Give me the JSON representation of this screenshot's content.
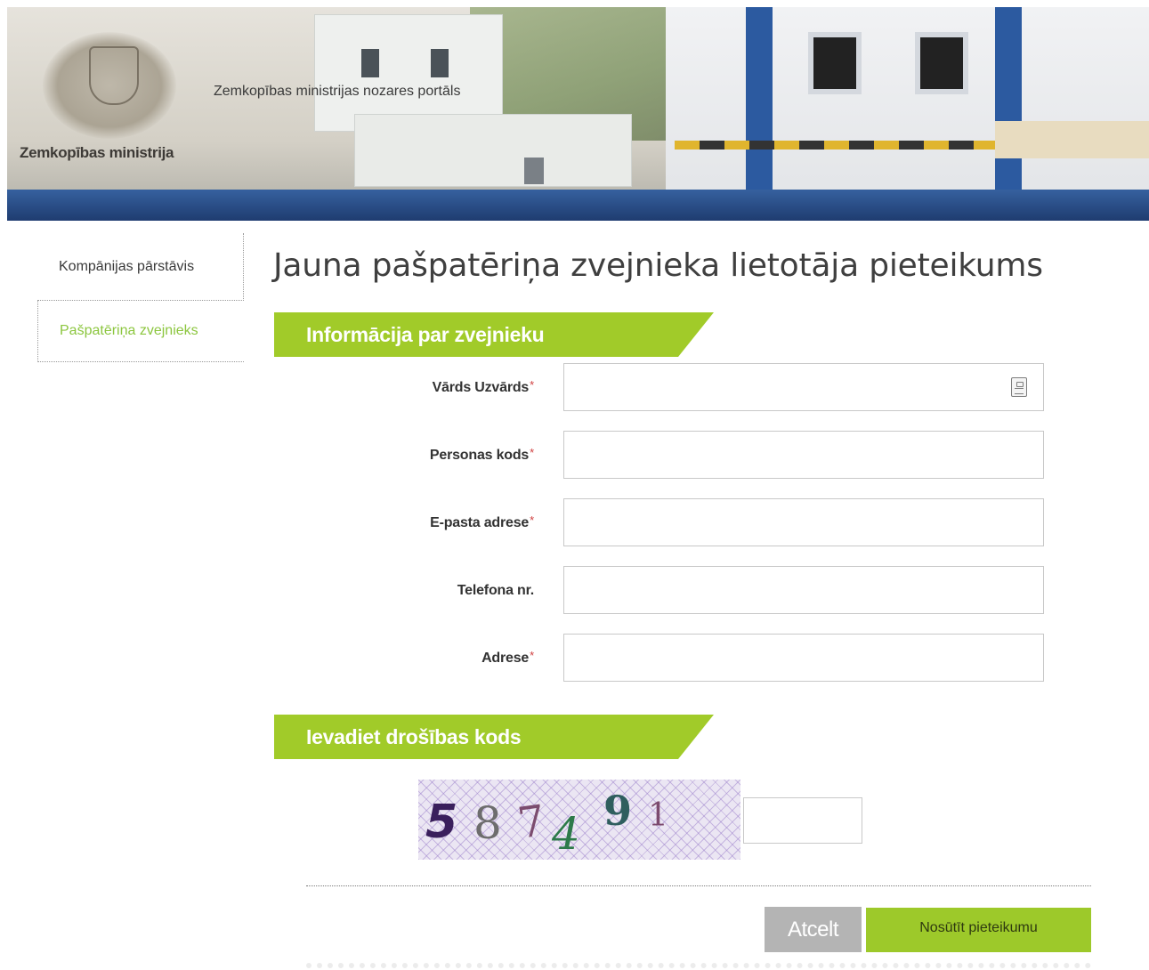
{
  "header": {
    "ministry_name": "Zemkopības ministrija",
    "portal_title": "Zemkopības ministrijas nozares portāls"
  },
  "sidebar": {
    "items": [
      {
        "label": "Kompānijas pārstāvis",
        "active": false
      },
      {
        "label": "Pašpatēriņa zvejnieks",
        "active": true
      }
    ]
  },
  "page": {
    "title": "Jauna pašpatēriņa zvejnieka lietotāja pieteikums"
  },
  "sections": {
    "fisher_info": "Informācija par zvejnieku",
    "security_code": "Ievadiet drošības kods"
  },
  "form": {
    "fields": [
      {
        "label": "Vārds Uzvārds",
        "required": true,
        "value": ""
      },
      {
        "label": "Personas kods",
        "required": true,
        "value": ""
      },
      {
        "label": "E-pasta adrese",
        "required": true,
        "value": ""
      },
      {
        "label": "Telefona nr.",
        "required": false,
        "value": ""
      },
      {
        "label": "Adrese",
        "required": true,
        "value": ""
      }
    ],
    "required_marker": "*"
  },
  "captcha": {
    "digits": [
      "5",
      "8",
      "7",
      "4",
      "9",
      "1"
    ],
    "input_value": ""
  },
  "buttons": {
    "cancel": "Atcelt",
    "submit": "Nosūtīt pieteikumu"
  },
  "colors": {
    "accent_green": "#a1cb29",
    "active_nav": "#8cc63f",
    "cancel_gray": "#b4b4b4"
  }
}
